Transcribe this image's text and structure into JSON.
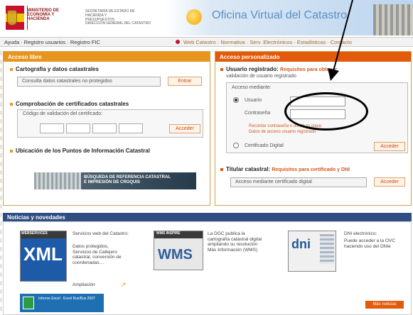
{
  "header": {
    "ministry_name": "MINISTERIO DE ECONOMÍA Y HACIENDA",
    "sub_org": "SECRETARÍA DE ESTADO DE HACIENDA Y PRESUPUESTOS",
    "direction": "DIRECCIÓN GENERAL DEL CATASTRO",
    "banner_title": "Oficina Virtual del Catastro"
  },
  "topnav": {
    "left": "Ayuda · Registro usuarios · Registro FIC",
    "right": "Web Catastro · Normativa · Serv. Electrónicos · Estadísticas · Contacto"
  },
  "left_panel": {
    "title": "Acceso libre",
    "sec1_title": "Cartografía y datos catastrales",
    "sec1_field": "Consulta datos catastrales no protegidos",
    "sec1_button": "Entrar",
    "sec2_title": "Comprobación de certificados catastrales",
    "sec2_label": "Código de validación del certificado:",
    "sec2_button": "Acceder",
    "sec3_title": "Ubicación de los Puntos de Información Catastral",
    "banner_line1": "BÚSQUEDA DE REFERENCIA CATASTRAL",
    "banner_line2": "E IMPRESIÓN DE CROQUIS"
  },
  "right_panel": {
    "title": "Acceso personalizado",
    "sec1_title": "Usuario registrado:",
    "sec1_intro_link": "Requisitos para obtener",
    "sec1_intro": "validación de usuario registrado",
    "access_label": "Acceso mediante:",
    "radio_user": "Usuario",
    "radio_pass": "Contraseña",
    "user_value": "",
    "pass_value": "",
    "recover_note1": "Recordar contraseña o olvidó su clave",
    "recover_note2": "Datos de acceso usuario registrado",
    "radio_cert": "Certificado Digital",
    "enter_button": "Acceder",
    "sec2_title": "Titular catastral:",
    "sec2_link": "Requisitos para certificado y DNI",
    "sec2_field": "Acceso mediante certificado digital",
    "sec2_button": "Acceder"
  },
  "news": {
    "title": "Noticias y novedades",
    "item1_tag": "WEBSERVICES",
    "item1_thumb": "XML",
    "item1_title": "Servicios web del Catastro:",
    "item1_text": "Datos protegidos, Servicios de Callejero catastral, conversión de coordenadas…",
    "item1_more": "Ampliación",
    "item2_tag": "WMS INSPIRE",
    "item2_thumb": "WMS",
    "item2_text": "La DGC publica la cartografía catastral digital ampliando su resolución Más Información (WMS)",
    "item3_thumb": "dni",
    "item3_title": "DNI electrónico:",
    "item3_text": "Puede acceder a la OVC haciendo uso del DNIe",
    "excel_text": "Informe Excel · Excel Bus/Bus 2007",
    "more_button": "Más noticias"
  }
}
